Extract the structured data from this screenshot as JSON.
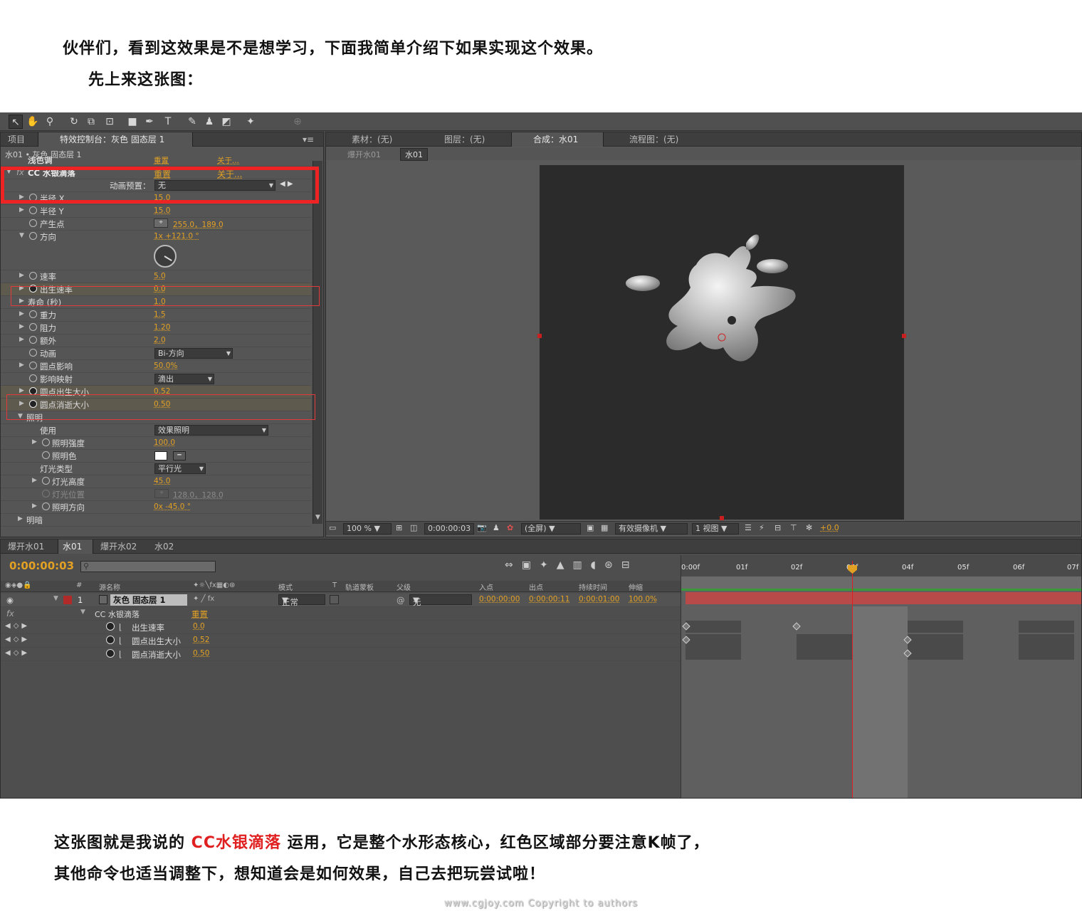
{
  "intro": {
    "line1": "伙伴们，看到这效果是不是想学习，下面我简单介绍下如果实现这个效果。",
    "line2": "先上来这张图："
  },
  "left_panel": {
    "tab_project": "项目",
    "tab_effects": "特效控制台：灰色 固态层 1",
    "breadcrumb": "水01 • 灰色 固态层 1",
    "prev_effect": {
      "name": "浅色调",
      "reset": "重置",
      "about": "关于..."
    },
    "effect": {
      "name": "CC 水银滴落",
      "reset": "重置",
      "about": "关于...",
      "preset_label": "动画预置：",
      "preset_value": "无"
    },
    "params": [
      {
        "label": "半径 X",
        "value": "15.0"
      },
      {
        "label": "半径 Y",
        "value": "15.0"
      },
      {
        "label": "产生点",
        "value": "255.0，189.0"
      },
      {
        "label": "方向",
        "value": "1x +121.0 °"
      },
      {
        "label": "速率",
        "value": "5.0"
      },
      {
        "label": "出生速率",
        "value": "0.0"
      },
      {
        "label": "寿命 (秒)",
        "value": "1.0"
      },
      {
        "label": "重力",
        "value": "1.5"
      },
      {
        "label": "阻力",
        "value": "1.20"
      },
      {
        "label": "额外",
        "value": "2.0"
      },
      {
        "label": "动画",
        "value": "Bi-方向"
      },
      {
        "label": "圆点影响",
        "value": "50.0%"
      },
      {
        "label": "影响映射",
        "value": "滴出"
      },
      {
        "label": "圆点出生大小",
        "value": "0.52"
      },
      {
        "label": "圆点消逝大小",
        "value": "0.50"
      },
      {
        "label": "照明",
        "value": ""
      },
      {
        "label": "使用",
        "value": "效果照明"
      },
      {
        "label": "照明强度",
        "value": "100.0"
      },
      {
        "label": "照明色",
        "value": ""
      },
      {
        "label": "灯光类型",
        "value": "平行光"
      },
      {
        "label": "灯光高度",
        "value": "45.0"
      },
      {
        "label": "灯光位置",
        "value": "128.0，128.0"
      },
      {
        "label": "照明方向",
        "value": "0x -45.0 °"
      },
      {
        "label": "明暗",
        "value": ""
      }
    ]
  },
  "viewer": {
    "tabs": [
      "素材：(无)",
      "图层：(无)",
      "合成：水01",
      "流程图：(无)"
    ],
    "breadcrumbs": [
      "爆开水01",
      "水01"
    ],
    "zoom": "100 %",
    "timecode": "0:00:00:03",
    "resolution": "(全屏)",
    "camera": "有效摄像机",
    "views": "1 视图",
    "exposure": "+0.0"
  },
  "timeline": {
    "tabs": [
      "爆开水01",
      "水01",
      "爆开水02",
      "水02"
    ],
    "timecode": "0:00:00:03",
    "headers": {
      "num": "#",
      "source": "源名称",
      "mode": "模式",
      "t": "T",
      "track": "轨道蒙板",
      "parent": "父级",
      "in": "入点",
      "out": "出点",
      "duration": "持续时间",
      "stretch": "伸缩"
    },
    "layer": {
      "num": "1",
      "name": "灰色 固态层 1",
      "mode": "正常",
      "parent": "无",
      "in": "0:00:00:00",
      "out": "0:00:00:11",
      "duration": "0:00:01:00",
      "stretch": "100.0%"
    },
    "effect_row": {
      "name": "CC 水银滴落",
      "reset": "重置"
    },
    "props": [
      {
        "name": "出生速率",
        "value": "0.0"
      },
      {
        "name": "圆点出生大小",
        "value": "0.52"
      },
      {
        "name": "圆点消逝大小",
        "value": "0.50"
      }
    ],
    "ruler": [
      "0:00f",
      "01f",
      "02f",
      "03f",
      "04f",
      "05f",
      "06f",
      "07f"
    ]
  },
  "outro": {
    "line1_pre": "这张图就是我说的 ",
    "line1_highlight": "CC水银滴落",
    "line1_post": "  运用，它是整个水形态核心，红色区域部分要注意K帧了，",
    "line2": "其他命令也适当调整下，想知道会是如何效果，自己去把玩尝试啦！"
  },
  "footer": "www.cgjoy.com  Copyright to authors",
  "colors": {
    "accent_value": "#e3a124",
    "highlight_red": "#e02020",
    "bar_red": "#b84a4a"
  }
}
